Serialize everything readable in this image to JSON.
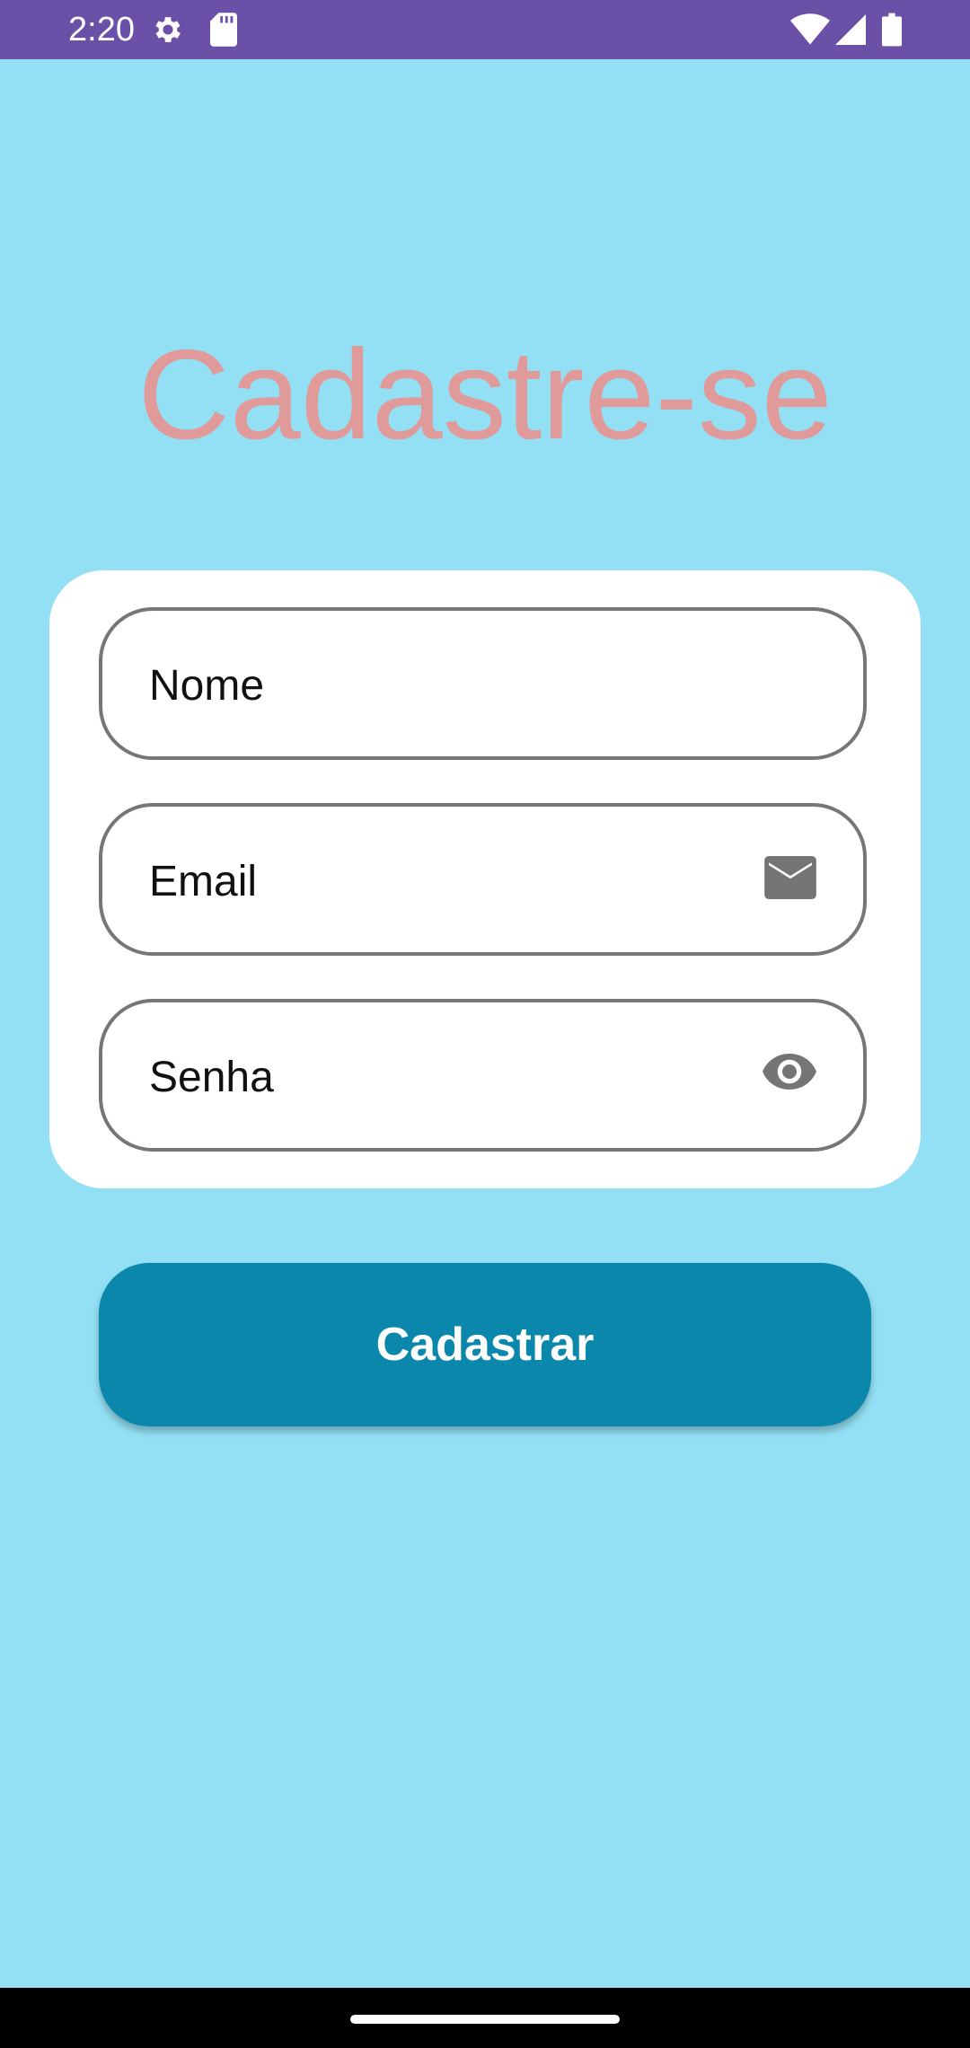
{
  "status_bar": {
    "time": "2:20",
    "icons": [
      "settings-icon",
      "sd-card-icon",
      "wifi-icon",
      "signal-icon",
      "battery-icon"
    ],
    "background": "#6a50a7"
  },
  "screen": {
    "title": "Cadastre-se",
    "title_color": "#e09a9a",
    "background": "#93e0f5"
  },
  "form": {
    "name_field": {
      "label": "Nome"
    },
    "email_field": {
      "label": "Email",
      "icon": "email-icon"
    },
    "password_field": {
      "label": "Senha",
      "icon": "eye-icon"
    }
  },
  "submit_button": {
    "label": "Cadastrar",
    "color": "#0a87ab"
  }
}
